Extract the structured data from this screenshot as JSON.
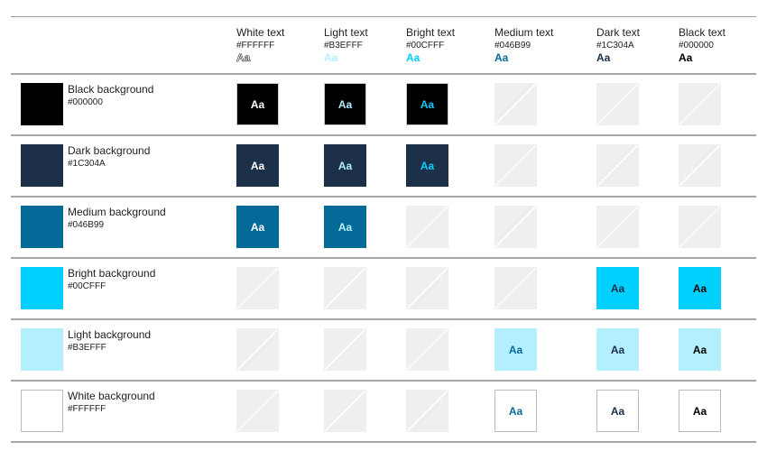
{
  "sample": "Aa",
  "columns": [
    {
      "name": "White text",
      "hex": "#FFFFFF"
    },
    {
      "name": "Light text",
      "hex": "#B3EFFF"
    },
    {
      "name": "Bright text",
      "hex": "#00CFFF"
    },
    {
      "name": "Medium text",
      "hex": "#046B99"
    },
    {
      "name": "Dark text",
      "hex": "#1C304A"
    },
    {
      "name": "Black text",
      "hex": "#000000"
    }
  ],
  "rows": [
    {
      "name": "Black background",
      "hex": "#000000",
      "allowed": [
        true,
        true,
        true,
        false,
        false,
        false
      ]
    },
    {
      "name": "Dark background",
      "hex": "#1C304A",
      "allowed": [
        true,
        true,
        true,
        false,
        false,
        false
      ]
    },
    {
      "name": "Medium background",
      "hex": "#046B99",
      "allowed": [
        true,
        true,
        false,
        false,
        false,
        false
      ]
    },
    {
      "name": "Bright background",
      "hex": "#00CFFF",
      "allowed": [
        false,
        false,
        false,
        false,
        true,
        true
      ]
    },
    {
      "name": "Light background",
      "hex": "#B3EFFF",
      "allowed": [
        false,
        false,
        false,
        true,
        true,
        true
      ]
    },
    {
      "name": "White background",
      "hex": "#FFFFFF",
      "allowed": [
        false,
        false,
        false,
        true,
        true,
        true
      ]
    }
  ]
}
